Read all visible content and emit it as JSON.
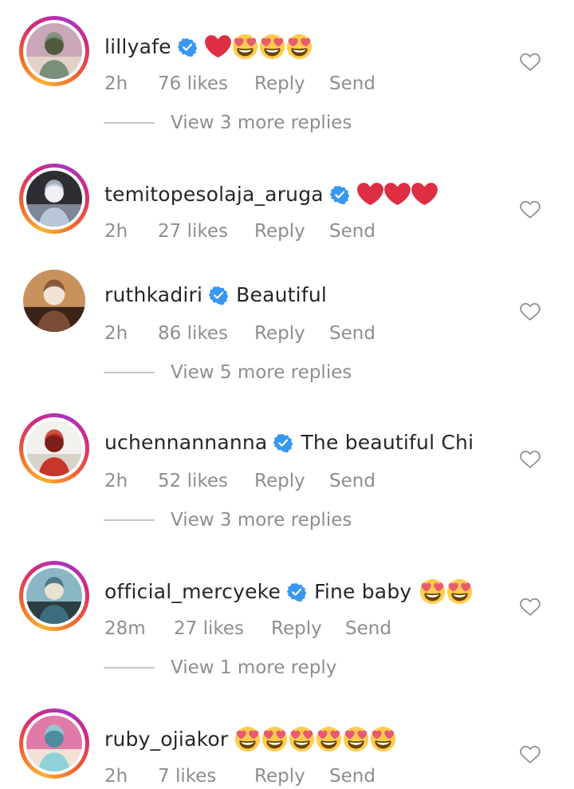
{
  "colors": {
    "text": "#262626",
    "secondary": "#8e8e8e",
    "verified": "#3897f0",
    "heart_red": "#ed4956",
    "story_ring": [
      "#f9b233",
      "#f2622c",
      "#d62a78",
      "#a635c4"
    ]
  },
  "comments": [
    {
      "username": "lillyafe",
      "verified": true,
      "text": "",
      "emojis": [
        "red-heart",
        "heart-eyes",
        "heart-eyes",
        "heart-eyes"
      ],
      "time": "2h",
      "likes": "76 likes",
      "reply_label": "Reply",
      "send_label": "Send",
      "story_ring": true,
      "view_replies": "View 3 more replies"
    },
    {
      "username": "temitopesolaja_aruga",
      "verified": true,
      "text": "",
      "emojis": [
        "red-heart",
        "red-heart",
        "red-heart"
      ],
      "time": "2h",
      "likes": "27 likes",
      "reply_label": "Reply",
      "send_label": "Send",
      "story_ring": true,
      "view_replies": ""
    },
    {
      "username": "ruthkadiri",
      "verified": true,
      "text": "Beautiful",
      "emojis": [],
      "time": "2h",
      "likes": "86 likes",
      "reply_label": "Reply",
      "send_label": "Send",
      "story_ring": false,
      "view_replies": "View 5 more replies"
    },
    {
      "username": "uchennannanna",
      "verified": true,
      "text": "The beautiful Chi",
      "emojis": [],
      "time": "2h",
      "likes": "52 likes",
      "reply_label": "Reply",
      "send_label": "Send",
      "story_ring": true,
      "view_replies": "View 3 more replies"
    },
    {
      "username": "official_mercyeke",
      "verified": true,
      "text": "Fine baby",
      "emojis": [
        "heart-eyes",
        "heart-eyes"
      ],
      "time": "28m",
      "likes": "27 likes",
      "reply_label": "Reply",
      "send_label": "Send",
      "story_ring": true,
      "view_replies": "View 1 more reply"
    },
    {
      "username": "ruby_ojiakor",
      "verified": false,
      "text": "",
      "emojis": [
        "heart-eyes",
        "heart-eyes",
        "heart-eyes",
        "heart-eyes",
        "heart-eyes",
        "heart-eyes"
      ],
      "time": "2h",
      "likes": "7 likes",
      "reply_label": "Reply",
      "send_label": "Send",
      "story_ring": true,
      "view_replies": ""
    }
  ]
}
